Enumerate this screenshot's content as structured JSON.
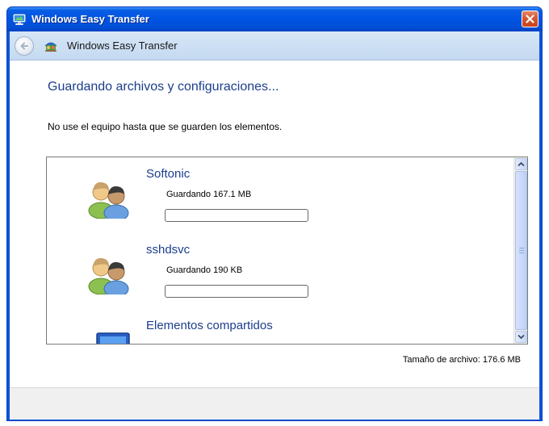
{
  "window": {
    "title": "Windows Easy Transfer"
  },
  "navbar": {
    "title": "Windows Easy Transfer"
  },
  "page": {
    "heading": "Guardando archivos y configuraciones...",
    "instruction": "No use el equipo hasta que se guarden los elementos."
  },
  "accounts": [
    {
      "name": "Softonic",
      "status": "Guardando 167.1 MB",
      "progress": 0,
      "icon": "users-icon"
    },
    {
      "name": "sshdsvc",
      "status": "Guardando 190 KB",
      "progress": 0,
      "icon": "users-icon"
    },
    {
      "name": "Elementos compartidos",
      "icon": "computer-icon"
    }
  ],
  "summary": {
    "file_size": "Tamaño de archivo:  176.6 MB"
  },
  "colors": {
    "accent_text": "#1c3e8c",
    "titlebar": "#0054e3",
    "navbar": "#c4d9f1",
    "close_button": "#d65a36"
  },
  "icons": {
    "app": "windows-easy-transfer-icon",
    "back": "back-arrow-icon",
    "close": "close-icon"
  }
}
